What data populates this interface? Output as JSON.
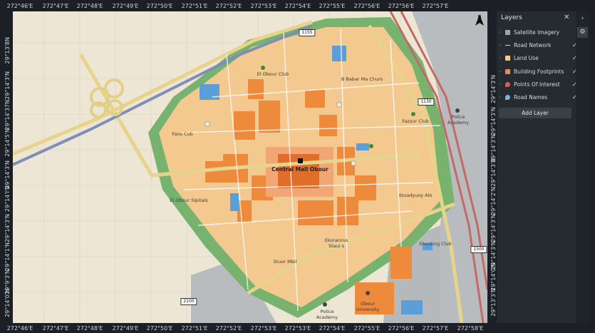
{
  "top_ticks": [
    "272°46'E",
    "272°47'E",
    "272°48'E",
    "272°49'E",
    "272°50'E",
    "272°51'E",
    "272°52'E",
    "272°53'E",
    "272°54'E",
    "272°55'E",
    "272°56'E",
    "272°56'E",
    "272°57'E"
  ],
  "bottom_ticks": [
    "272°46'E",
    "272°47'E",
    "272°48'E",
    "272°49'E",
    "272°50'E",
    "272°51'E",
    "272°52'E",
    "272°53'E",
    "272°53'E",
    "272°54'E",
    "272°55'E",
    "272°56'E",
    "272°57'E",
    "272°58'E"
  ],
  "left_ticks": [
    "29°13'8N",
    "29°14'3'N",
    "29°14'37N",
    "29°14'5'N",
    "29°14'3'N",
    "29°14'I'N",
    "29°14'3'N",
    "29°14'1'N",
    "29°9'3'N",
    "29°14'0'N"
  ],
  "right_ticks": [
    "29°14'3'N",
    "29°14'3'N",
    "29°14'3'N",
    "29°14'3'N",
    "29°14'2'N",
    "29°14'3'N",
    "29°14'3'N",
    "29°14'0'N",
    "29°13'3'N"
  ],
  "north": {
    "label": "N"
  },
  "road_numbers": {
    "r1155": "1155",
    "r1130": "1130",
    "r1500": "1500",
    "r2100": "2100"
  },
  "map_labels": {
    "el_obour_club": "El Obour Club",
    "babar": "B Babar Ma Churs",
    "fans_cub": "Fans Cub",
    "central_mall": "Central Mall Obour",
    "fazzur": "Fazzur Club",
    "police_academy_top": "Police\nAcademy",
    "hospitals": "El Obour Sipitals",
    "stadium": "Stoadyuoy Alo",
    "ekoranrus": "Ekoranrus\nStaui s",
    "shooting": "Shooting Club",
    "stuor": "Stuor Mbil",
    "obour_univ": "Obour\nUniversity",
    "police_academy_bottom": "Police\nAcademy"
  },
  "panel": {
    "title": "Layers",
    "add_layer": "Add Layer",
    "layers": [
      {
        "label": "Satellite Imagery",
        "icon": "satellite-icon",
        "checked": false
      },
      {
        "label": "Road Network",
        "icon": "road-line-icon",
        "checked": true
      },
      {
        "label": "Land Use",
        "icon": "land-use-icon",
        "checked": true
      },
      {
        "label": "Building Footprints",
        "icon": "building-icon",
        "checked": true
      },
      {
        "label": "Points Of Interest",
        "icon": "poi-pin-icon",
        "checked": true
      },
      {
        "label": "Road Names",
        "icon": "road-name-pin-icon",
        "checked": true
      }
    ]
  },
  "colors": {
    "land_use": "#f6c98a",
    "buildings": "#ee8a3c",
    "poi": "#e05a4a",
    "road_names": "#6fb7e0",
    "park": "#6fb06a"
  }
}
